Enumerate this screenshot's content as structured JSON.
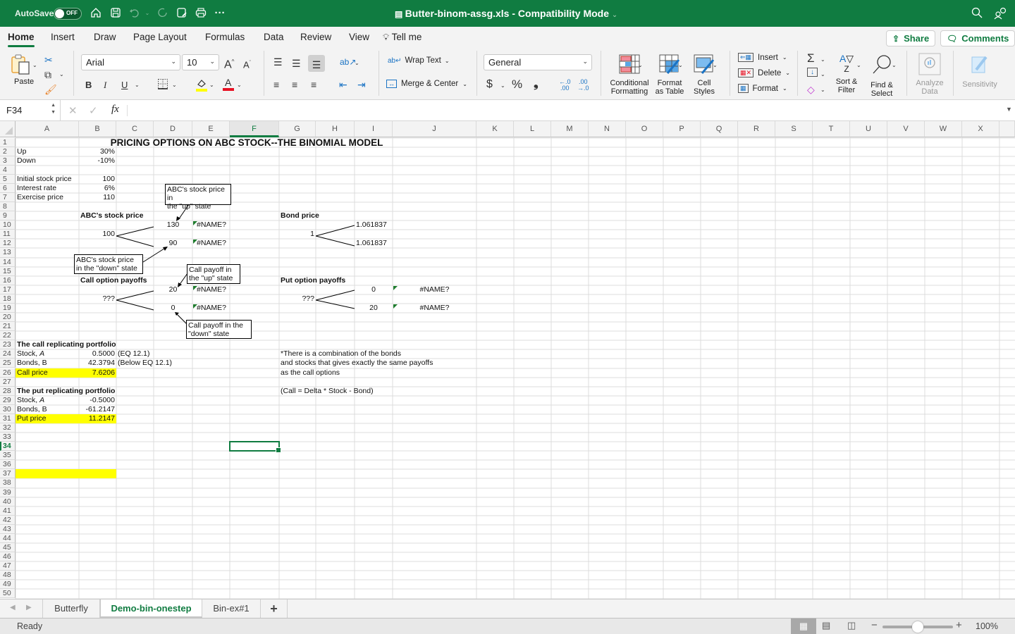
{
  "titlebar": {
    "autosave_label": "AutoSave",
    "autosave_state": "OFF",
    "doc_title": "Butter-binom-assg.xls  -  Compatibility Mode",
    "icons": [
      "home-icon",
      "save-icon",
      "undo-icon",
      "redo-icon",
      "save-as-icon",
      "print-icon",
      "more-icon",
      "search-icon",
      "collaborate-icon"
    ]
  },
  "menu": {
    "tabs": [
      "Home",
      "Insert",
      "Draw",
      "Page Layout",
      "Formulas",
      "Data",
      "Review",
      "View"
    ],
    "active": "Home",
    "tell_me": "Tell me",
    "share": "Share",
    "comments": "Comments"
  },
  "ribbon": {
    "paste": "Paste",
    "font_name": "Arial",
    "font_size": "10",
    "bold": "B",
    "italic": "I",
    "underline": "U",
    "wrap_text": "Wrap Text",
    "merge_center": "Merge & Center",
    "number_format": "General",
    "currency": "$",
    "percent": "%",
    "comma": ")",
    "cond_format": [
      "Conditional",
      "Formatting"
    ],
    "format_table": [
      "Format",
      "as Table"
    ],
    "cell_styles": [
      "Cell",
      "Styles"
    ],
    "insert": "Insert",
    "delete": "Delete",
    "format": "Format",
    "sort_filter": [
      "Sort &",
      "Filter"
    ],
    "find_select": [
      "Find &",
      "Select"
    ],
    "analyze": [
      "Analyze",
      "Data"
    ],
    "sensitivity": "Sensitivity",
    "colors": {
      "highlight": "#ffff00",
      "font_color": "#e81123",
      "accent": "#107c41"
    }
  },
  "formula_bar": {
    "name_box": "F34",
    "fx": "fx",
    "formula": ""
  },
  "grid": {
    "columns": [
      "A",
      "B",
      "C",
      "D",
      "E",
      "F",
      "G",
      "H",
      "I",
      "J",
      "K",
      "L",
      "M",
      "N",
      "O",
      "P",
      "Q",
      "R",
      "S",
      "T",
      "U",
      "V",
      "W",
      "X"
    ],
    "selected_column": "F",
    "selected_row": 34,
    "selected_cell": "F34",
    "row_count": 50
  },
  "sheet": {
    "title": "PRICING OPTIONS ON ABC STOCK--THE BINOMIAL MODEL",
    "inputs": [
      {
        "row": 2,
        "label": "Up",
        "value": "30%"
      },
      {
        "row": 3,
        "label": "Down",
        "value": "-10%"
      },
      {
        "row": 5,
        "label": "Initial stock price",
        "value": "100"
      },
      {
        "row": 6,
        "label": "Interest rate",
        "value": "6%"
      },
      {
        "row": 7,
        "label": "Exercise price",
        "value": "110"
      }
    ],
    "stock_tree": {
      "heading": "ABC's stock price",
      "root": "100",
      "up": "130",
      "down": "90",
      "up_err": "#NAME?",
      "down_err": "#NAME?"
    },
    "bond_tree": {
      "heading": "Bond price",
      "root": "1",
      "up": "1.061837",
      "down": "1.061837"
    },
    "call_tree": {
      "heading": "Call option payoffs",
      "root": "???",
      "up": "20",
      "down": "0",
      "up_err": "#NAME?",
      "down_err": "#NAME?"
    },
    "put_tree": {
      "heading": "Put option payoffs",
      "root": "???",
      "up": "0",
      "down": "20",
      "up_err": "#NAME?",
      "down_err": "#NAME?"
    },
    "callouts": {
      "stock_up": [
        "ABC's stock price in",
        "the \"up\" state"
      ],
      "stock_down": [
        "ABC's stock price",
        "in the \"down\" state"
      ],
      "call_up": [
        "Call payoff in",
        "the \"up\" state"
      ],
      "call_down": [
        "Call payoff in the",
        "\"down\" state"
      ]
    },
    "call_portfolio": {
      "heading": "The call replicating portfolio",
      "stock_label": "Stock, ",
      "stock_sym": "A",
      "stock_value": "0.5000",
      "stock_note": "(EQ 12.1)",
      "bonds_label": "Bonds, B",
      "bonds_value": "42.3794",
      "bonds_note": "(Below EQ 12.1)",
      "price_label": "Call price",
      "price_value": "7.6206"
    },
    "put_portfolio": {
      "heading": "The put replicating portfolio",
      "stock_label": "Stock, ",
      "stock_sym": "A",
      "stock_value": "-0.5000",
      "bonds_label": "Bonds, B",
      "bonds_value": "-61.2147",
      "price_label": "Put price",
      "price_value": "11.2147"
    },
    "notes": [
      "*There is a combination of the bonds",
      "and stocks that gives exactly the same payoffs",
      "as the call options",
      "(Call = Delta * Stock - Bond)"
    ]
  },
  "sheet_tabs": {
    "tabs": [
      "Butterfly",
      "Demo-bin-onestep",
      "Bin-ex#1"
    ],
    "active": "Demo-bin-onestep",
    "add": "+"
  },
  "status": {
    "text": "Ready",
    "zoom": "100%",
    "zoom_fraction": 0.5
  }
}
